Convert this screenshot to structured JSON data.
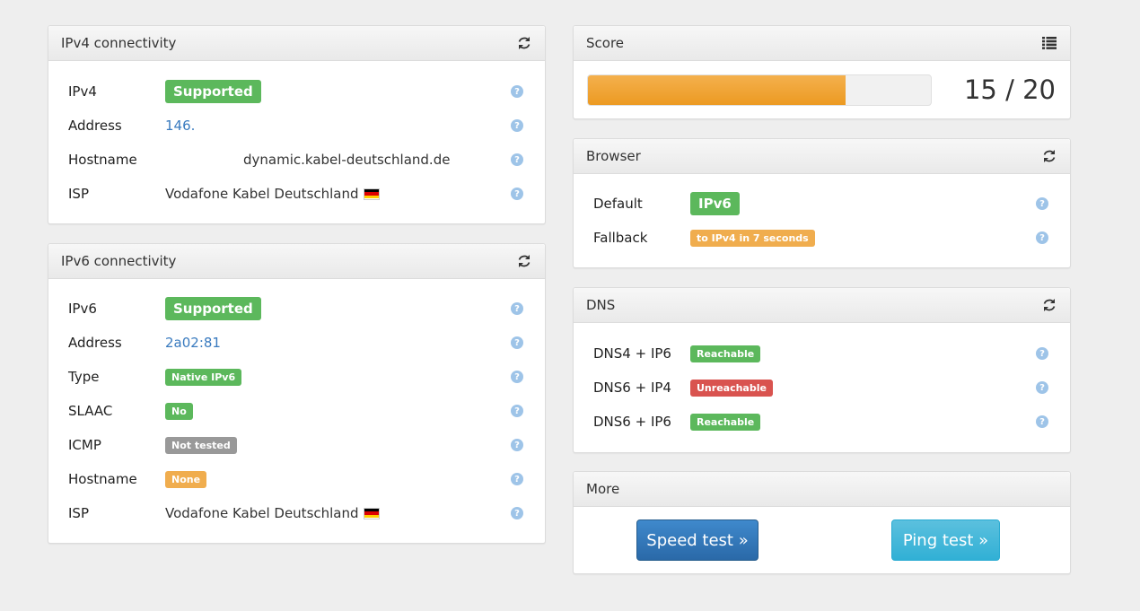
{
  "ipv4": {
    "title": "IPv4 connectivity",
    "rows": [
      {
        "label": "IPv4",
        "value": "Supported"
      },
      {
        "label": "Address",
        "value": "146."
      },
      {
        "label": "Hostname",
        "value": "dynamic.kabel-deutschland.de"
      },
      {
        "label": "ISP",
        "value": "Vodafone Kabel Deutschland"
      }
    ]
  },
  "ipv6": {
    "title": "IPv6 connectivity",
    "rows": [
      {
        "label": "IPv6",
        "value": "Supported"
      },
      {
        "label": "Address",
        "value": "2a02:81"
      },
      {
        "label": "Type",
        "value": "Native IPv6"
      },
      {
        "label": "SLAAC",
        "value": "No"
      },
      {
        "label": "ICMP",
        "value": "Not tested"
      },
      {
        "label": "Hostname",
        "value": "None"
      },
      {
        "label": "ISP",
        "value": "Vodafone Kabel Deutschland"
      }
    ]
  },
  "score": {
    "title": "Score",
    "text": "15 / 20",
    "value": 15,
    "max": 20
  },
  "browser": {
    "title": "Browser",
    "rows": [
      {
        "label": "Default",
        "value": "IPv6"
      },
      {
        "label": "Fallback",
        "value": "to IPv4 in 7 seconds"
      }
    ]
  },
  "dns": {
    "title": "DNS",
    "rows": [
      {
        "label": "DNS4 + IP6",
        "value": "Reachable"
      },
      {
        "label": "DNS6 + IP4",
        "value": "Unreachable"
      },
      {
        "label": "DNS6 + IP6",
        "value": "Reachable"
      }
    ]
  },
  "more": {
    "title": "More",
    "speed_label": "Speed test »",
    "ping_label": "Ping test »"
  },
  "help_glyph": "?",
  "colors": {
    "success": "#5cb85c",
    "danger": "#d9534f",
    "warning": "#f0ad4e",
    "default": "#999999",
    "progress": "#ec9a22",
    "link": "#3a7bbf"
  },
  "icons": {
    "refresh": "refresh-icon",
    "list": "list-icon",
    "help": "help-icon",
    "flag": "germany-flag-icon"
  }
}
